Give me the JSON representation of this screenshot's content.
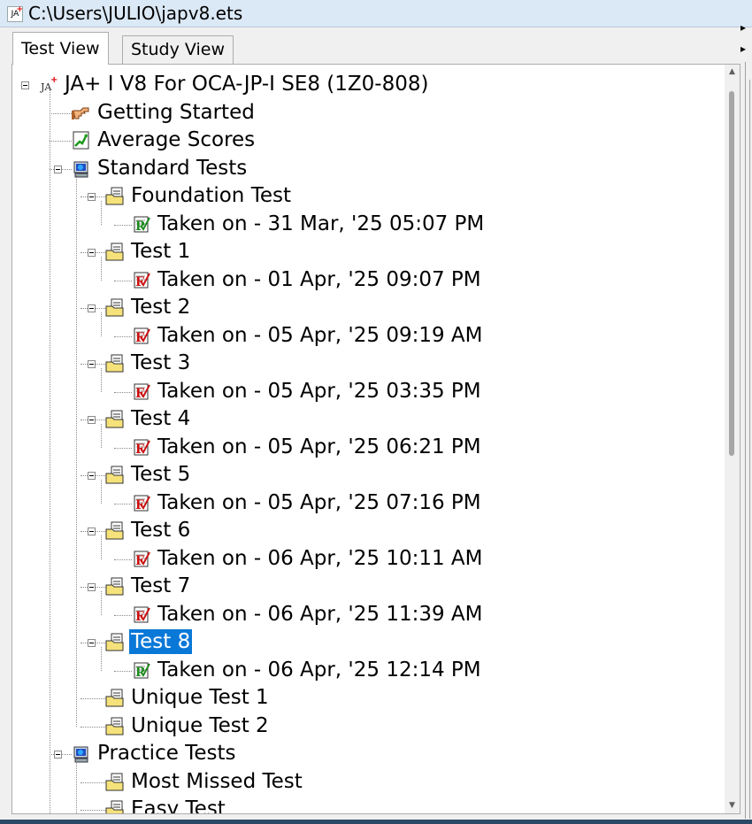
{
  "window": {
    "title": "C:\\Users\\JULIO\\japv8.ets",
    "app_icon_text": "JA"
  },
  "tabs": [
    {
      "label": "Test View",
      "active": true
    },
    {
      "label": "Study View",
      "active": false
    }
  ],
  "tree": {
    "root": {
      "label": "JA+ I V8 For OCA-JP-I SE8 (1Z0-808)",
      "icon": "ja-app-icon"
    },
    "getting_started": {
      "label": "Getting Started",
      "icon": "pointing-hand-icon"
    },
    "average_scores": {
      "label": "Average Scores",
      "icon": "chart-icon"
    },
    "standard_tests": {
      "label": "Standard Tests",
      "icon": "computer-icon",
      "tests": [
        {
          "label": "Foundation Test",
          "taken": "Taken on - 31 Mar, '25 05:07 PM",
          "result": "pass"
        },
        {
          "label": "Test 1",
          "taken": "Taken on - 01 Apr, '25 09:07 PM",
          "result": "fail"
        },
        {
          "label": "Test 2",
          "taken": "Taken on - 05 Apr, '25 09:19 AM",
          "result": "fail"
        },
        {
          "label": "Test 3",
          "taken": "Taken on - 05 Apr, '25 03:35 PM",
          "result": "fail"
        },
        {
          "label": "Test 4",
          "taken": "Taken on - 05 Apr, '25 06:21 PM",
          "result": "fail"
        },
        {
          "label": "Test 5",
          "taken": "Taken on - 05 Apr, '25 07:16 PM",
          "result": "fail"
        },
        {
          "label": "Test 6",
          "taken": "Taken on - 06 Apr, '25 10:11 AM",
          "result": "fail"
        },
        {
          "label": "Test 7",
          "taken": "Taken on - 06 Apr, '25 11:39 AM",
          "result": "fail"
        },
        {
          "label": "Test 8",
          "taken": "Taken on - 06 Apr, '25 12:14 PM",
          "result": "pass",
          "selected": true
        }
      ],
      "unique": [
        {
          "label": "Unique Test 1"
        },
        {
          "label": "Unique Test 2"
        }
      ]
    },
    "practice_tests": {
      "label": "Practice Tests",
      "icon": "computer-icon",
      "tests": [
        {
          "label": "Most Missed Test"
        },
        {
          "label": "Easy Test"
        }
      ]
    }
  },
  "colors": {
    "selection": "#0a78d7",
    "pass_mark": "#1f8a1f",
    "fail_mark": "#cc1111",
    "folder": "#f5e27a"
  }
}
